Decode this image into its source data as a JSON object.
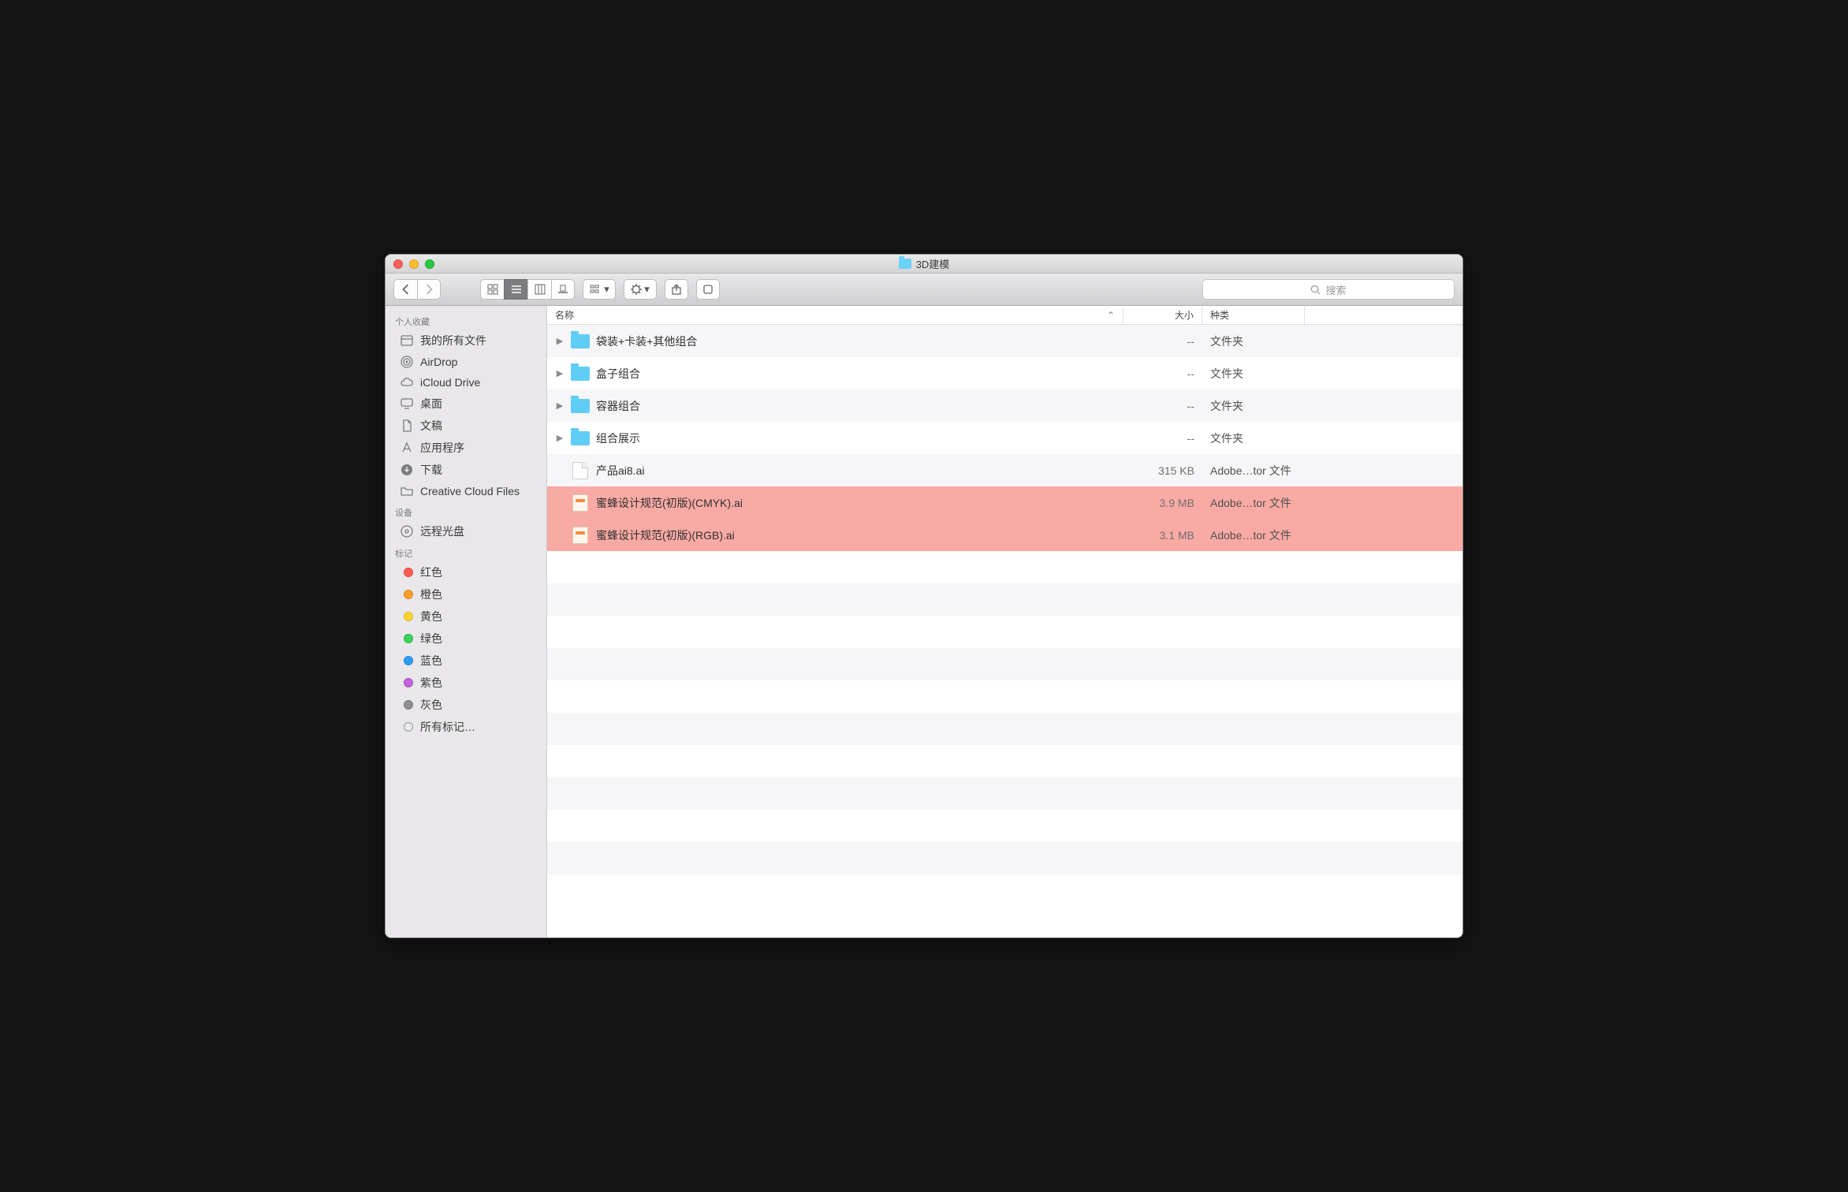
{
  "window": {
    "title": "3D建模"
  },
  "search": {
    "placeholder": "搜索"
  },
  "sidebar": {
    "sections": [
      {
        "header": "个人收藏",
        "items": [
          {
            "icon": "all-files",
            "label": "我的所有文件"
          },
          {
            "icon": "airdrop",
            "label": "AirDrop"
          },
          {
            "icon": "cloud",
            "label": "iCloud Drive"
          },
          {
            "icon": "desktop",
            "label": "桌面"
          },
          {
            "icon": "documents",
            "label": "文稿"
          },
          {
            "icon": "applications",
            "label": "应用程序"
          },
          {
            "icon": "downloads",
            "label": "下载"
          },
          {
            "icon": "folder",
            "label": "Creative Cloud Files"
          }
        ]
      },
      {
        "header": "设备",
        "items": [
          {
            "icon": "disc",
            "label": "远程光盘"
          }
        ]
      },
      {
        "header": "标记",
        "items": [
          {
            "icon": "tag",
            "color": "#ff5a52",
            "label": "红色"
          },
          {
            "icon": "tag",
            "color": "#ff9e2a",
            "label": "橙色"
          },
          {
            "icon": "tag",
            "color": "#ffd52e",
            "label": "黄色"
          },
          {
            "icon": "tag",
            "color": "#3bd35d",
            "label": "绿色"
          },
          {
            "icon": "tag",
            "color": "#2e9ef7",
            "label": "蓝色"
          },
          {
            "icon": "tag",
            "color": "#c361de",
            "label": "紫色"
          },
          {
            "icon": "tag",
            "color": "#8e8e93",
            "label": "灰色"
          },
          {
            "icon": "tag",
            "color": "transparent",
            "label": "所有标记…"
          }
        ]
      }
    ]
  },
  "columns": {
    "name": "名称",
    "size": "大小",
    "kind": "种类"
  },
  "files": [
    {
      "type": "folder",
      "name": "袋装+卡装+其他组合",
      "size": "--",
      "kind": "文件夹",
      "disclosure": true,
      "highlight": false
    },
    {
      "type": "folder",
      "name": "盒子组合",
      "size": "--",
      "kind": "文件夹",
      "disclosure": true,
      "highlight": false
    },
    {
      "type": "folder",
      "name": "容器组合",
      "size": "--",
      "kind": "文件夹",
      "disclosure": true,
      "highlight": false
    },
    {
      "type": "folder",
      "name": "组合展示",
      "size": "--",
      "kind": "文件夹",
      "disclosure": true,
      "highlight": false
    },
    {
      "type": "doc",
      "name": "产品ai8.ai",
      "size": "315 KB",
      "kind": "Adobe…tor 文件",
      "disclosure": false,
      "highlight": false
    },
    {
      "type": "ai",
      "name": "蜜蜂设计规范(初版)(CMYK).ai",
      "size": "3.9 MB",
      "kind": "Adobe…tor 文件",
      "disclosure": false,
      "highlight": true
    },
    {
      "type": "ai",
      "name": "蜜蜂设计规范(初版)(RGB).ai",
      "size": "3.1 MB",
      "kind": "Adobe…tor 文件",
      "disclosure": false,
      "highlight": true
    }
  ],
  "empty_rows": 11
}
